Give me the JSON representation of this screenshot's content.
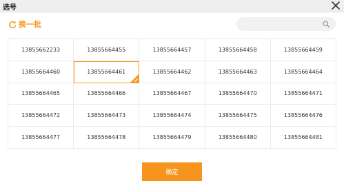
{
  "window": {
    "title": "选号"
  },
  "toolbar": {
    "refresh_label": "换一批",
    "search_value": ""
  },
  "numbers": [
    "13855662233",
    "13855664455",
    "13855664457",
    "13855664458",
    "13855664459",
    "13855664460",
    "13855664461",
    "13855664462",
    "13855664463",
    "13855664464",
    "13855664465",
    "13855664466",
    "13855664467",
    "13855664470",
    "13855664471",
    "13855664472",
    "13855664473",
    "13855664474",
    "13855664475",
    "13855664476",
    "13855664477",
    "13855664478",
    "13855664479",
    "13855664480",
    "13855664481"
  ],
  "selected_number": "13855664461",
  "footer": {
    "confirm_label": "确定"
  },
  "colors": {
    "accent": "#f39b1f",
    "button": "#f7941d",
    "titlebar": "#efefef"
  },
  "icons": {
    "close": "close-icon",
    "refresh": "refresh-icon",
    "search": "search-icon",
    "selected": "checkmark-icon"
  }
}
